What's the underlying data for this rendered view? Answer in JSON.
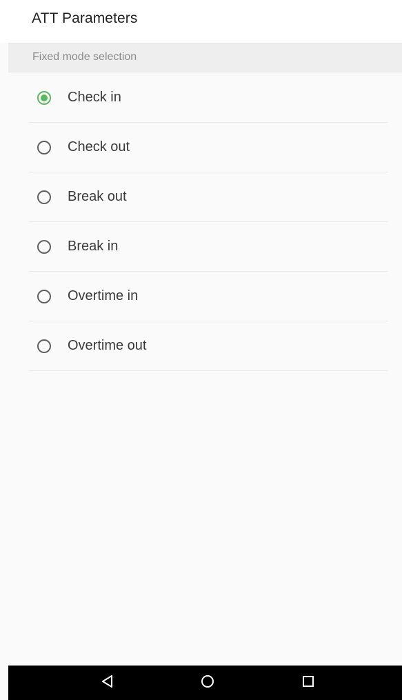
{
  "header": {
    "title": "ATT Parameters"
  },
  "section": {
    "title": "Fixed mode selection"
  },
  "options": [
    {
      "label": "Check in",
      "selected": true
    },
    {
      "label": "Check out",
      "selected": false
    },
    {
      "label": "Break out",
      "selected": false
    },
    {
      "label": "Break in",
      "selected": false
    },
    {
      "label": "Overtime in",
      "selected": false
    },
    {
      "label": "Overtime out",
      "selected": false
    }
  ],
  "nav": {
    "back_icon": "back-triangle-icon",
    "home_icon": "home-circle-icon",
    "recent_icon": "recent-apps-square-icon"
  },
  "colors": {
    "accent": "#5cb85c",
    "section_bg": "#eeeeee",
    "nav_bg": "#000000"
  }
}
